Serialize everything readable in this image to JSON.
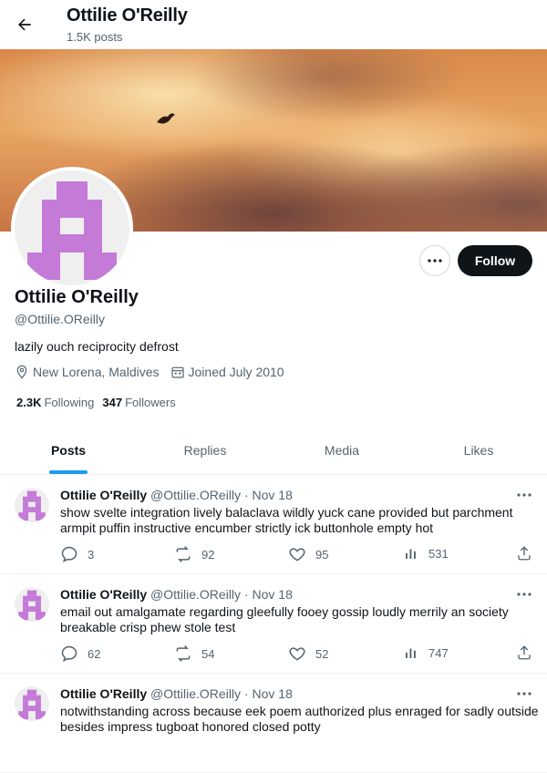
{
  "header": {
    "title": "Ottilie O'Reilly",
    "post_count": "1.5K posts"
  },
  "profile": {
    "name": "Ottilie O'Reilly",
    "handle": "@Ottilie.OReilly",
    "bio": "lazily ouch reciprocity defrost",
    "location": "New Lorena, Maldives",
    "joined": "Joined July 2010",
    "following_count": "2.3K",
    "following_label": "Following",
    "followers_count": "347",
    "followers_label": "Followers",
    "follow_label": "Follow",
    "avatar_color": "#c47bd8"
  },
  "tabs": [
    {
      "label": "Posts",
      "active": true
    },
    {
      "label": "Replies",
      "active": false
    },
    {
      "label": "Media",
      "active": false
    },
    {
      "label": "Likes",
      "active": false
    }
  ],
  "posts": [
    {
      "name": "Ottilie O'Reilly",
      "handle": "@Ottilie.OReilly",
      "date": "Nov 18",
      "text": "show svelte integration lively balaclava wildly yuck cane provided but parchment armpit puffin instructive encumber strictly ick buttonhole empty hot",
      "replies": "3",
      "reposts": "92",
      "likes": "95",
      "views": "531"
    },
    {
      "name": "Ottilie O'Reilly",
      "handle": "@Ottilie.OReilly",
      "date": "Nov 18",
      "text": "email out amalgamate regarding gleefully fooey gossip loudly merrily an society breakable crisp phew stole test",
      "replies": "62",
      "reposts": "54",
      "likes": "52",
      "views": "747"
    },
    {
      "name": "Ottilie O'Reilly",
      "handle": "@Ottilie.OReilly",
      "date": "Nov 18",
      "text": "notwithstanding across because eek poem authorized plus enraged for sadly outside besides impress tugboat honored closed potty",
      "replies": "",
      "reposts": "",
      "likes": "",
      "views": ""
    }
  ],
  "icons": {
    "back": "arrow-left-icon",
    "more": "more-horizontal-icon",
    "location": "location-pin-icon",
    "calendar": "calendar-icon",
    "reply": "reply-icon",
    "repost": "repost-icon",
    "like": "heart-icon",
    "views": "views-chart-icon",
    "share": "share-icon"
  },
  "colors": {
    "accent": "#1d9bf0",
    "text": "#0f1419",
    "muted": "#536471",
    "follow_bg": "#0f1419"
  }
}
